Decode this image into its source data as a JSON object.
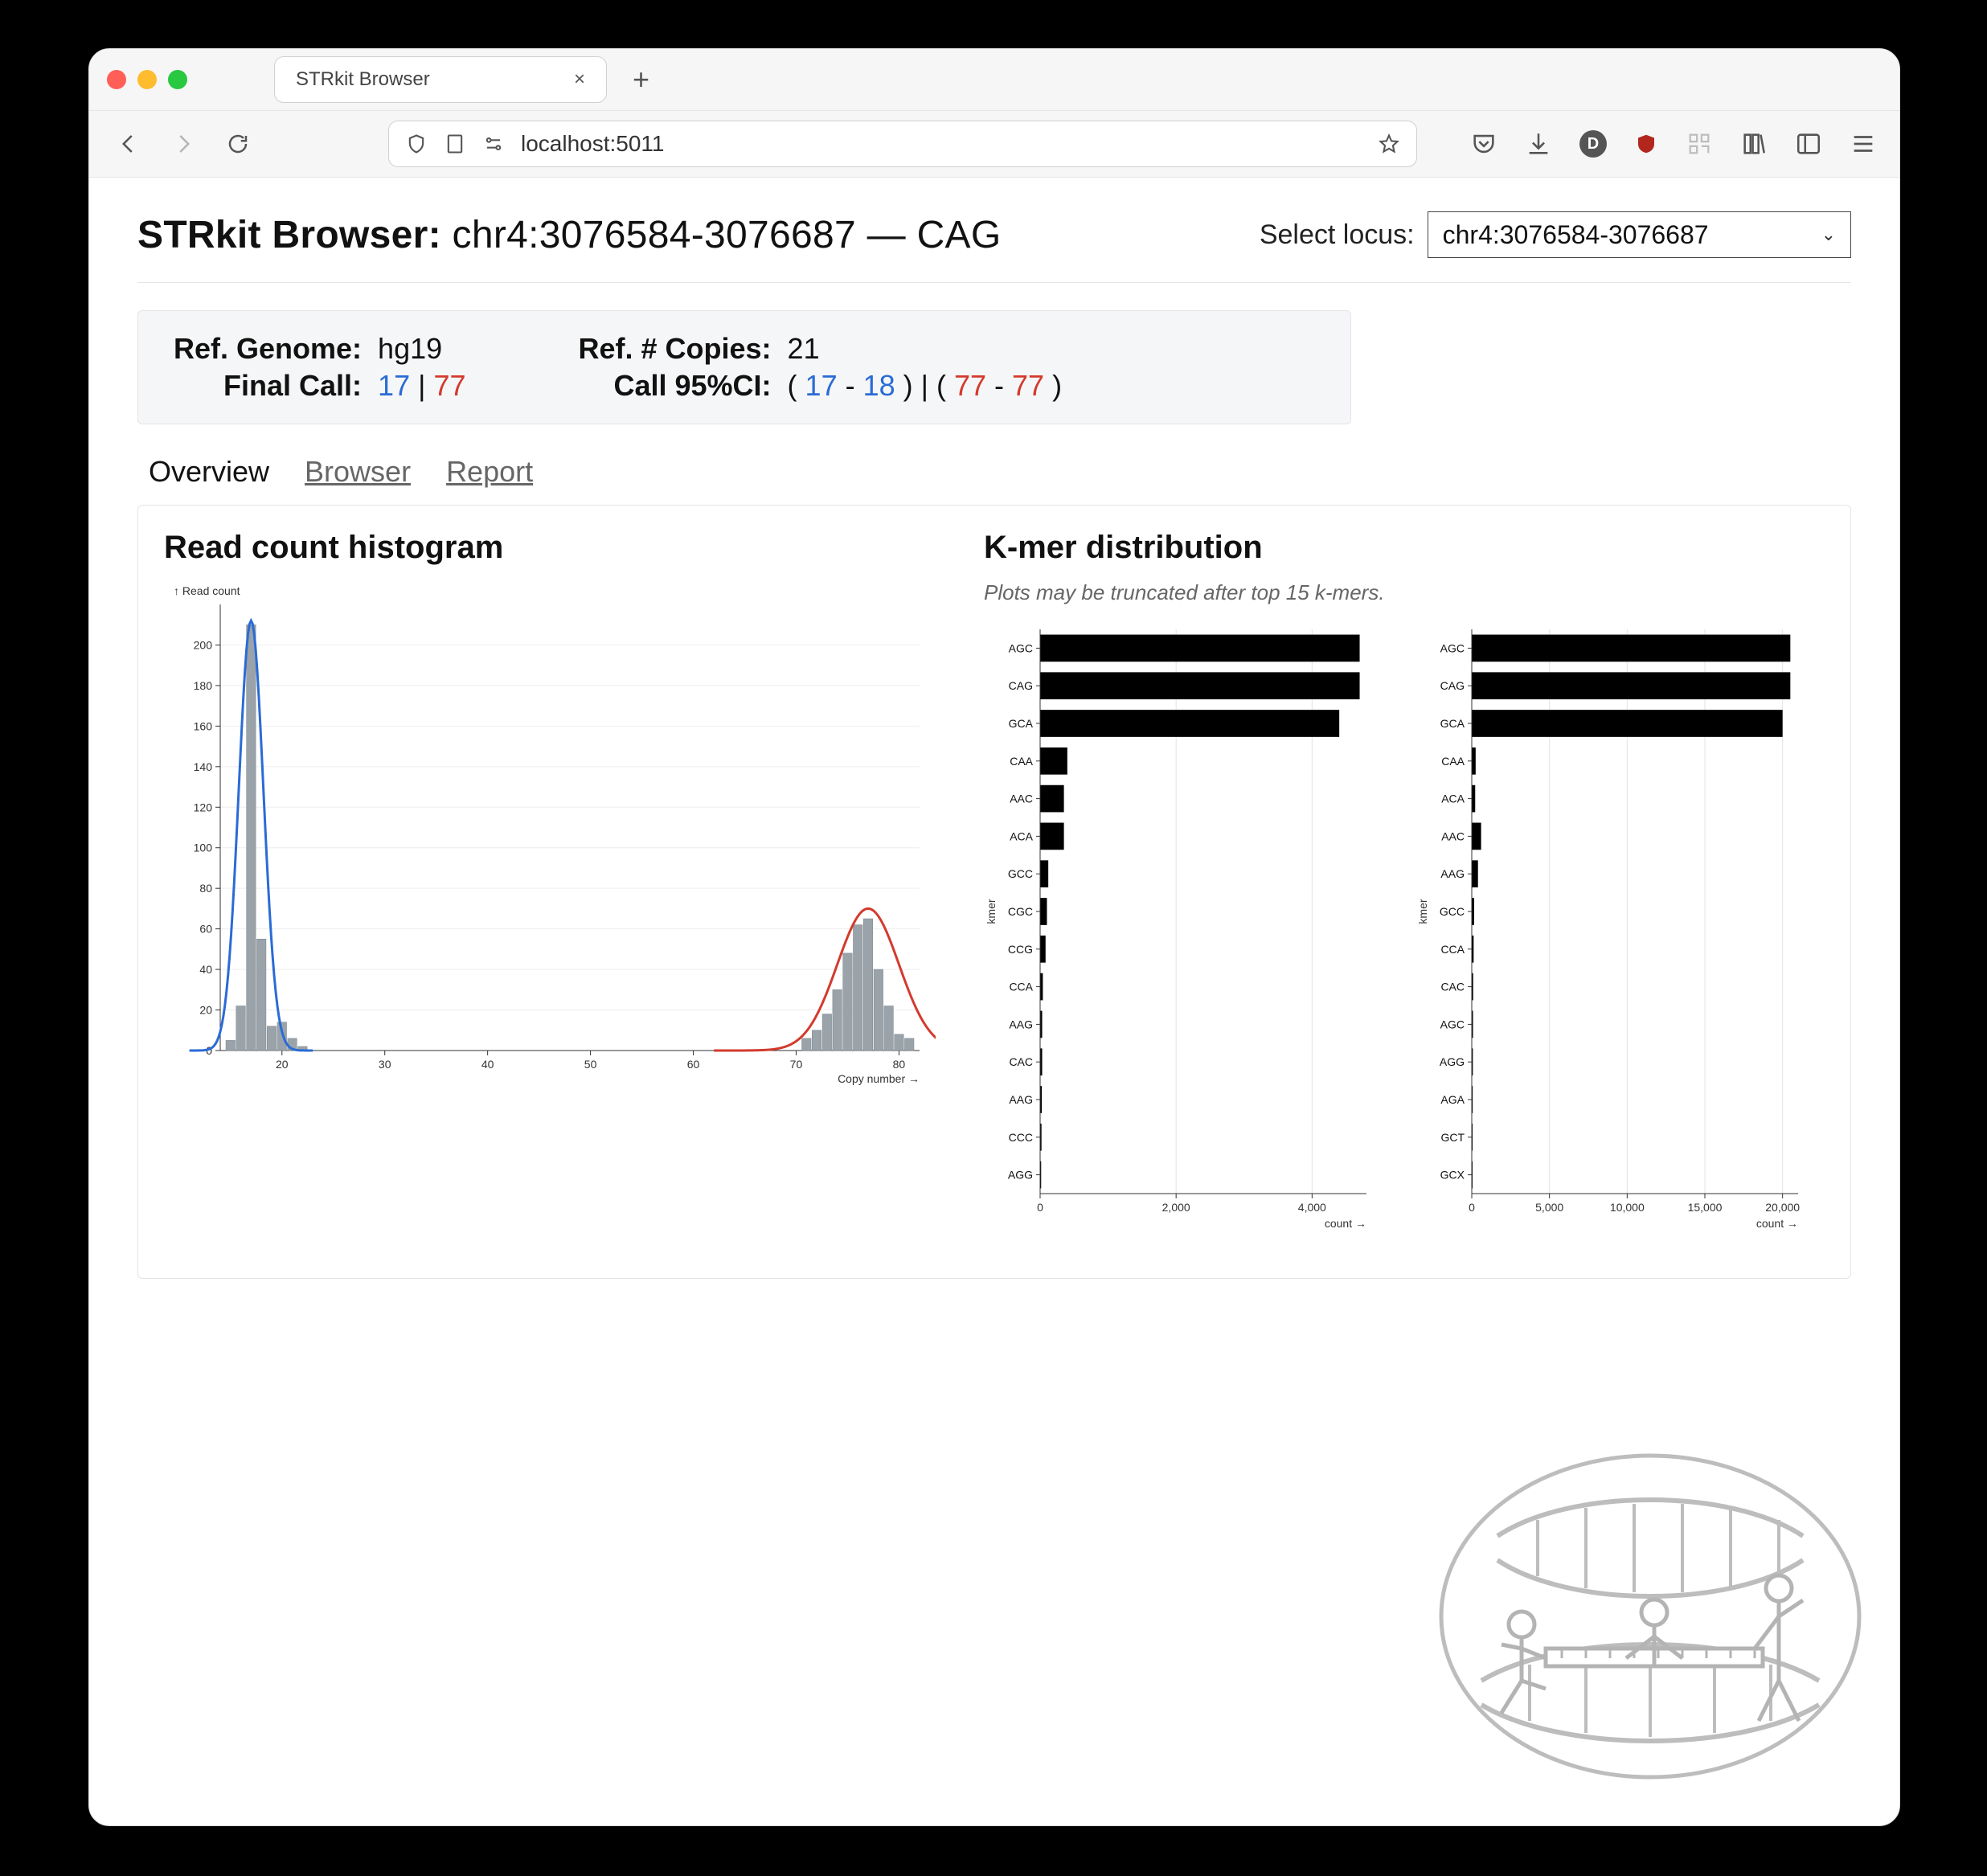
{
  "browser_tab": {
    "title": "STRkit Browser"
  },
  "address_bar": {
    "url": "localhost:5011"
  },
  "heading": {
    "app_name": "STRkit Browser:",
    "locus": "chr4:3076584-3076687",
    "sep": " — ",
    "motif": "CAG"
  },
  "select_locus": {
    "label": "Select locus:",
    "value": "chr4:3076584-3076687"
  },
  "panel": {
    "ref_genome_label": "Ref. Genome:",
    "ref_genome_value": "hg19",
    "ref_copies_label": "Ref. # Copies:",
    "ref_copies_value": "21",
    "final_call_label": "Final Call:",
    "final_call_a": "17",
    "final_call_sep": " | ",
    "final_call_b": "77",
    "ci_label": "Call 95%CI:",
    "ci_open": "( ",
    "ci_a_lo": "17",
    "ci_dash": " - ",
    "ci_a_hi": "18",
    "ci_mid": " ) | ( ",
    "ci_b_lo": "77",
    "ci_b_hi": "77",
    "ci_close": " )"
  },
  "subtabs": {
    "overview": "Overview",
    "browser": "Browser",
    "report": "Report"
  },
  "hist": {
    "title": "Read count histogram",
    "ylabel": "↑ Read count",
    "xlabel": "Copy number →"
  },
  "kmer": {
    "title": "K-mer distribution",
    "note": "Plots may be truncated after top 15 k-mers.",
    "xlabel": "count →",
    "ylabel": "kmer"
  },
  "chart_data": [
    {
      "type": "bar",
      "title": "Read count histogram",
      "xlabel": "Copy number →",
      "ylabel": "↑ Read count",
      "xlim": [
        14,
        82
      ],
      "ylim": [
        0,
        220
      ],
      "xticks": [
        20,
        30,
        40,
        50,
        60,
        70,
        80
      ],
      "yticks": [
        0,
        20,
        40,
        60,
        80,
        100,
        120,
        140,
        160,
        180,
        200
      ],
      "x": [
        15,
        16,
        17,
        18,
        19,
        20,
        21,
        22,
        71,
        72,
        73,
        74,
        75,
        76,
        77,
        78,
        79,
        80,
        81
      ],
      "values": [
        5,
        22,
        210,
        55,
        12,
        14,
        6,
        2,
        6,
        10,
        18,
        30,
        48,
        62,
        65,
        40,
        22,
        8,
        6
      ],
      "gaussians": [
        {
          "mu": 17,
          "sigma": 1.2,
          "amp": 212,
          "color": "#2a6bd6"
        },
        {
          "mu": 77,
          "sigma": 3.0,
          "amp": 70,
          "color": "#d33a2d"
        }
      ]
    },
    {
      "type": "bar",
      "orientation": "horizontal",
      "title": "K-mer distribution (left)",
      "xlabel": "count →",
      "ylabel": "kmer",
      "xlim": [
        0,
        4800
      ],
      "xticks": [
        0,
        2000,
        4000
      ],
      "xticklabels": [
        "0",
        "2,000",
        "4,000"
      ],
      "categories": [
        "AGC",
        "CAG",
        "GCA",
        "CAA",
        "AAC",
        "ACA",
        "GCC",
        "CGC",
        "CCG",
        "CCA",
        "AAG",
        "CAC",
        "AAG",
        "CCC",
        "AGG"
      ],
      "values": [
        4700,
        4700,
        4400,
        400,
        350,
        350,
        120,
        100,
        80,
        40,
        30,
        30,
        25,
        20,
        15
      ]
    },
    {
      "type": "bar",
      "orientation": "horizontal",
      "title": "K-mer distribution (right)",
      "xlabel": "count →",
      "ylabel": "kmer",
      "xlim": [
        0,
        21000
      ],
      "xticks": [
        0,
        5000,
        10000,
        15000,
        20000
      ],
      "xticklabels": [
        "0",
        "5,000",
        "10,000",
        "15,000",
        "20,000"
      ],
      "categories": [
        "AGC",
        "CAG",
        "GCA",
        "CAA",
        "ACA",
        "AAC",
        "AAG",
        "GCC",
        "CCA",
        "CAC",
        "AGC",
        "AGG",
        "AGA",
        "GCT",
        "GCX"
      ],
      "values": [
        20500,
        20500,
        20000,
        250,
        220,
        600,
        400,
        150,
        120,
        90,
        80,
        70,
        60,
        55,
        50
      ]
    }
  ]
}
